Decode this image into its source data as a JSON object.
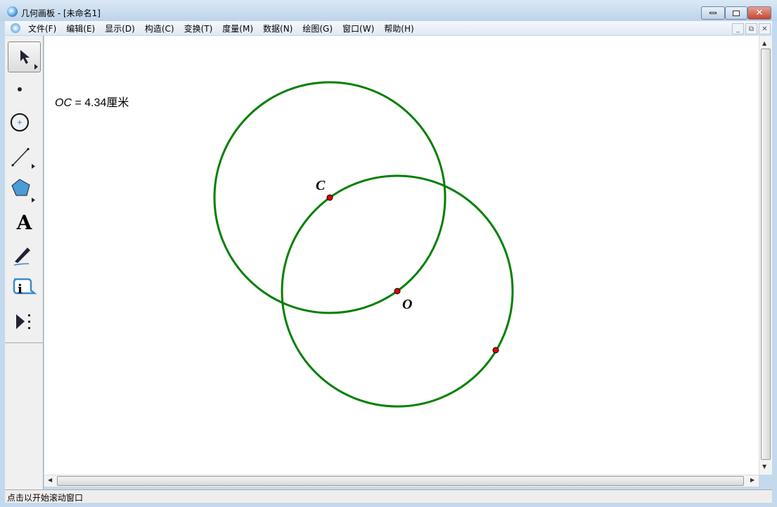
{
  "window": {
    "title": "几何画板 - [未命名1]"
  },
  "menu": [
    "文件(F)",
    "编辑(E)",
    "显示(D)",
    "构造(C)",
    "变换(T)",
    "度量(M)",
    "数据(N)",
    "绘图(G)",
    "窗口(W)",
    "帮助(H)"
  ],
  "measurement": {
    "label": "OC",
    "equals": " = 4.34",
    "unit": "厘米"
  },
  "points": {
    "c": "C",
    "o": "O"
  },
  "colors": {
    "circle": "#008000",
    "point": "#e00000"
  },
  "status": "点击以开始滚动窗口",
  "tools": [
    "arrow-tool-icon",
    "point-tool-icon",
    "compass-tool-icon",
    "straightedge-tool-icon",
    "polygon-tool-icon",
    "text-tool-icon",
    "marker-tool-icon",
    "information-tool-icon",
    "custom-tool-icon"
  ]
}
